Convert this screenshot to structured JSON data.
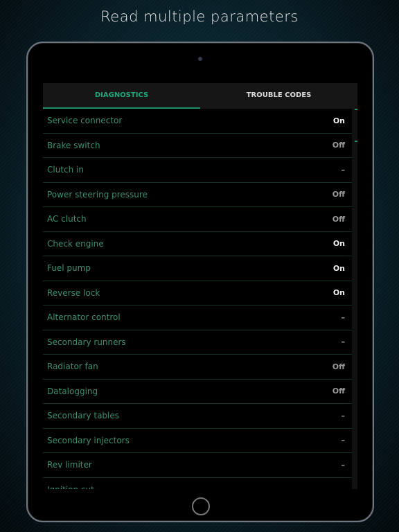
{
  "headline": "Read multiple parameters",
  "tabs": [
    {
      "label": "DIAGNOSTICS",
      "active": true
    },
    {
      "label": "TROUBLE CODES",
      "active": false
    }
  ],
  "rows": [
    {
      "label": "Service connector",
      "value": "On"
    },
    {
      "label": "Brake switch",
      "value": "Off"
    },
    {
      "label": "Clutch in",
      "value": "–"
    },
    {
      "label": "Power steering pressure",
      "value": "Off"
    },
    {
      "label": "AC clutch",
      "value": "Off"
    },
    {
      "label": "Check engine",
      "value": "On"
    },
    {
      "label": "Fuel pump",
      "value": "On"
    },
    {
      "label": "Reverse lock",
      "value": "On"
    },
    {
      "label": "Alternator control",
      "value": "–"
    },
    {
      "label": "Secondary runners",
      "value": "–"
    },
    {
      "label": "Radiator fan",
      "value": "Off"
    },
    {
      "label": "Datalogging",
      "value": "Off"
    },
    {
      "label": "Secondary tables",
      "value": "–"
    },
    {
      "label": "Secondary injectors",
      "value": "–"
    },
    {
      "label": "Rev limiter",
      "value": "–"
    },
    {
      "label": "Ignition cut",
      "value": ""
    }
  ],
  "colors": {
    "accent": "#23a57a",
    "label": "#3a8f74"
  }
}
